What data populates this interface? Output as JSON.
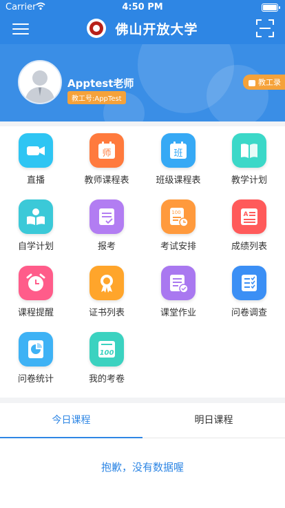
{
  "status_bar": {
    "carrier": "Carrier",
    "time": "4:50 PM"
  },
  "header": {
    "title": "佛山开放大学"
  },
  "profile": {
    "name": "Apptest老师",
    "staff_id": "教工号:AppTest",
    "directory_button": "教工录"
  },
  "grid": {
    "items": [
      {
        "label": "直播",
        "icon": "video-camera-icon",
        "color": "#2ec5f3"
      },
      {
        "label": "教师课程表",
        "icon": "calendar-teacher-icon",
        "color": "#ff7a3d"
      },
      {
        "label": "班级课程表",
        "icon": "calendar-class-icon",
        "color": "#36a9f5"
      },
      {
        "label": "教学计划",
        "icon": "open-book-icon",
        "color": "#3bd8c8"
      },
      {
        "label": "自学计划",
        "icon": "reader-icon",
        "color": "#3bc9d8"
      },
      {
        "label": "报考",
        "icon": "checklist-icon",
        "color": "#b27df2"
      },
      {
        "label": "考试安排",
        "icon": "exam-schedule-icon",
        "color": "#ff9a3d"
      },
      {
        "label": "成绩列表",
        "icon": "grade-list-icon",
        "color": "#ff5a5a"
      },
      {
        "label": "课程提醒",
        "icon": "alarm-clock-icon",
        "color": "#ff5c8a"
      },
      {
        "label": "证书列表",
        "icon": "certificate-icon",
        "color": "#ffa52b"
      },
      {
        "label": "课堂作业",
        "icon": "homework-icon",
        "color": "#a978f0"
      },
      {
        "label": "问卷调查",
        "icon": "survey-icon",
        "color": "#3b8ff5"
      },
      {
        "label": "问卷统计",
        "icon": "pie-report-icon",
        "color": "#3eb2f5"
      },
      {
        "label": "我的考卷",
        "icon": "exam-paper-icon",
        "color": "#3bd2c0"
      }
    ]
  },
  "tabs": [
    {
      "label": "今日课程",
      "active": true
    },
    {
      "label": "明日课程",
      "active": false
    }
  ],
  "empty_message": "抱歉，没有数据喔"
}
